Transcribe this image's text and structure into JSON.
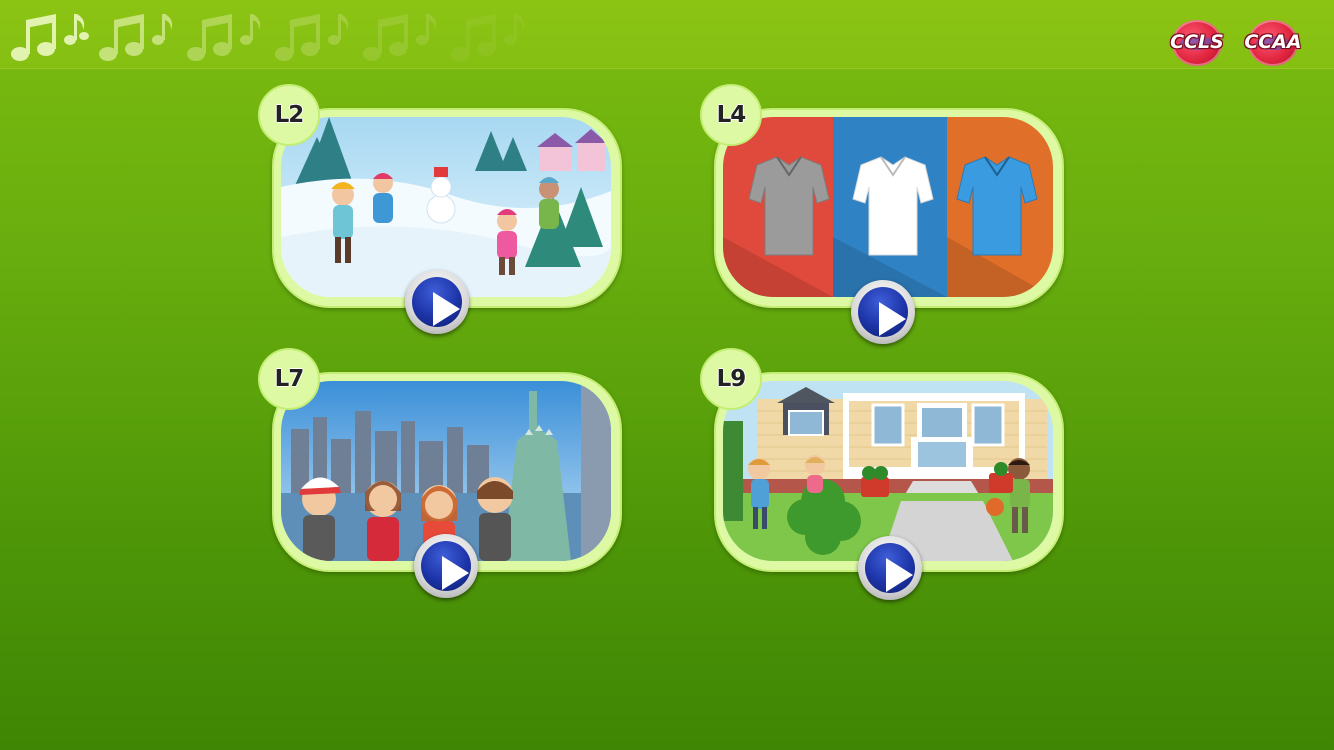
{
  "header": {
    "icon": "music-notes-icon",
    "logos": [
      "CCLS",
      "CCAA"
    ]
  },
  "lessons": [
    {
      "label": "L2",
      "scene": "winter-snow-play-scene",
      "play_icon": "play-icon"
    },
    {
      "label": "L4",
      "scene": "shirts-colors-scene",
      "play_icon": "play-icon"
    },
    {
      "label": "L7",
      "scene": "city-statue-of-liberty-scene",
      "play_icon": "play-icon"
    },
    {
      "label": "L9",
      "scene": "house-neighborhood-scene",
      "play_icon": "play-icon"
    }
  ],
  "colors": {
    "background": "#5ea70c",
    "card_frame": "#ddf9a4",
    "play_button": "#1d34a8"
  }
}
